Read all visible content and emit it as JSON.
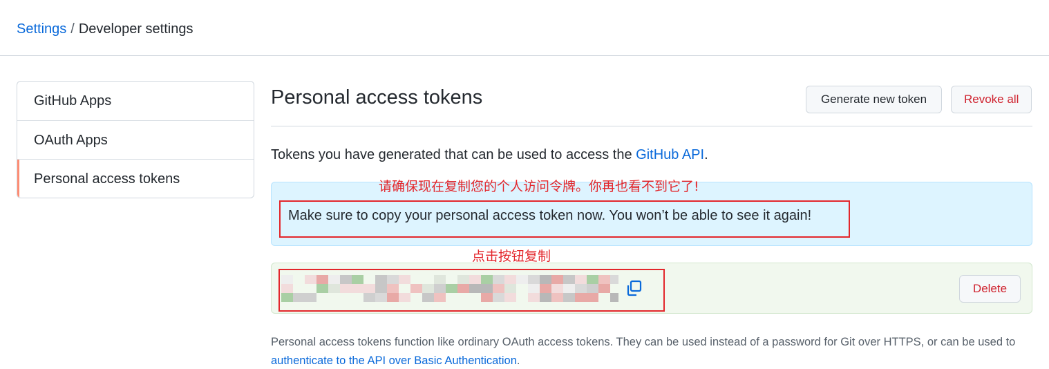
{
  "breadcrumb": {
    "root": "Settings",
    "separator": "/",
    "current": "Developer settings"
  },
  "sidebar": {
    "items": [
      {
        "label": "GitHub Apps"
      },
      {
        "label": "OAuth Apps"
      },
      {
        "label": "Personal access tokens",
        "selected": true
      }
    ]
  },
  "main": {
    "title": "Personal access tokens",
    "generate_button": "Generate new token",
    "revoke_button": "Revoke all",
    "intro": {
      "prefix": "Tokens you have generated that can be used to access the ",
      "link": "GitHub API",
      "suffix": "."
    },
    "flash_message": "Make sure to copy your personal access token now. You won’t be able to see it again!",
    "token": {
      "masked": true,
      "copy_icon": "copy-icon",
      "delete_button": "Delete"
    },
    "footer": {
      "text": "Personal access tokens function like ordinary OAuth access tokens. They can be used instead of a password for Git over HTTPS, or can be used to ",
      "link": "authenticate to the API over Basic Authentication",
      "suffix": "."
    }
  },
  "annotations": {
    "flash_note": "请确保现在复制您的个人访问令牌。你再也看不到它了!",
    "copy_note": "点击按钮复制",
    "color": "#e3262b"
  },
  "colors": {
    "link": "#0969da",
    "danger": "#cf222e",
    "flash_bg": "#ddf4ff",
    "token_bg": "#f1f8ee",
    "sidebar_accent": "#fd8c73"
  }
}
